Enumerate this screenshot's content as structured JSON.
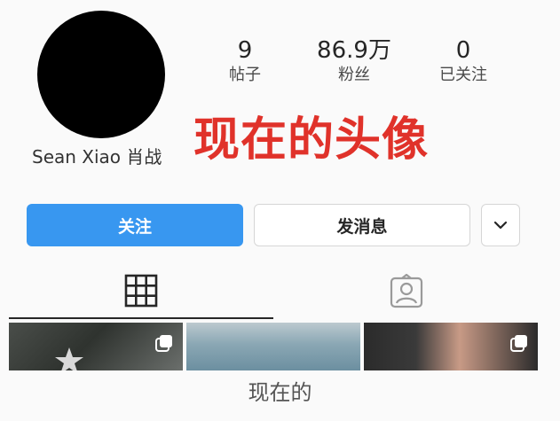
{
  "profile": {
    "username": "Sean Xiao 肖战",
    "stats": {
      "posts": {
        "value": "9",
        "label": "帖子"
      },
      "fans": {
        "value": "86.9万",
        "label": "粉丝"
      },
      "following": {
        "value": "0",
        "label": "已关注"
      }
    }
  },
  "annotation": {
    "text": "现在的头像",
    "color": "#e0322a"
  },
  "actions": {
    "follow_label": "关注",
    "message_label": "发消息",
    "more_icon": "chevron-down-icon"
  },
  "tabs": {
    "grid_icon": "grid-icon",
    "tagged_icon": "tagged-person-icon"
  },
  "caption": "现在的",
  "colors": {
    "accent": "#3897f0",
    "annotation": "#e0322a"
  }
}
